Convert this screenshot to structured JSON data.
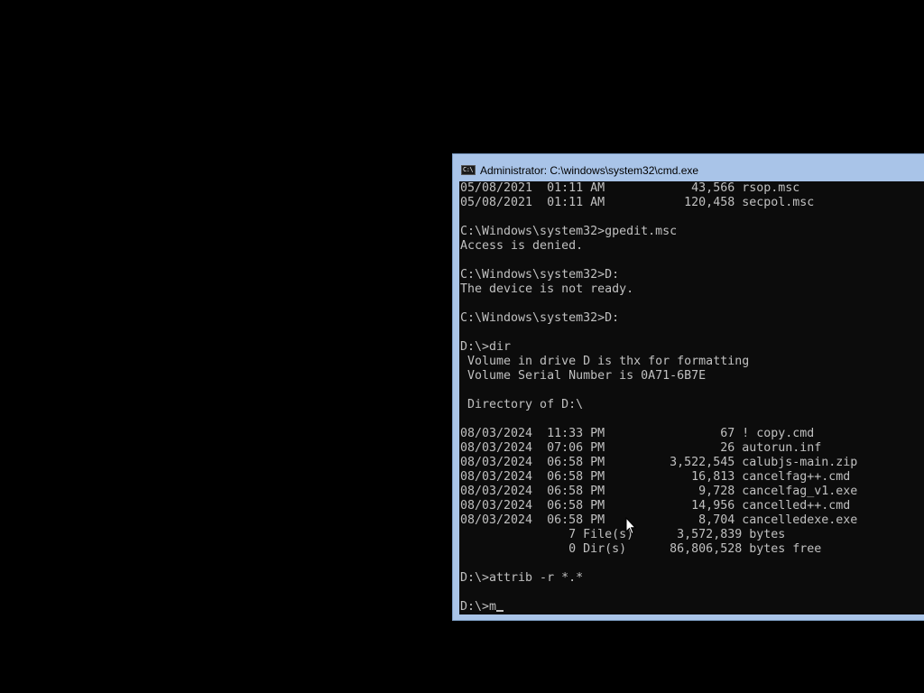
{
  "window": {
    "title": "Administrator: C:\\windows\\system32\\cmd.exe",
    "icon_label": "C:\\",
    "icon_name": "cmd-app-icon"
  },
  "console": {
    "lines": [
      "05/08/2021  01:11 AM            43,566 rsop.msc",
      "05/08/2021  01:11 AM           120,458 secpol.msc",
      "",
      "C:\\Windows\\system32>gpedit.msc",
      "Access is denied.",
      "",
      "C:\\Windows\\system32>D:",
      "The device is not ready.",
      "",
      "C:\\Windows\\system32>D:",
      "",
      "D:\\>dir",
      " Volume in drive D is thx for formatting",
      " Volume Serial Number is 0A71-6B7E",
      "",
      " Directory of D:\\",
      "",
      "08/03/2024  11:33 PM                67 ! copy.cmd",
      "08/03/2024  07:06 PM                26 autorun.inf",
      "08/03/2024  06:58 PM         3,522,545 calubjs-main.zip",
      "08/03/2024  06:58 PM            16,813 cancelfag++.cmd",
      "08/03/2024  06:58 PM             9,728 cancelfag_v1.exe",
      "08/03/2024  06:58 PM            14,956 cancelled++.cmd",
      "08/03/2024  06:58 PM             8,704 cancelledexe.exe",
      "               7 File(s)      3,572,839 bytes",
      "               0 Dir(s)      86,806,528 bytes free",
      "",
      "D:\\>attrib -r *.*",
      ""
    ],
    "prompt": "D:\\>",
    "current_input": "m"
  },
  "colors": {
    "desktop": "#000000",
    "title_bar": "#a9c4e8",
    "console_background": "#0c0c0c",
    "console_text": "#c0c0c0"
  },
  "icons": {
    "mouse_pointer": "arrow-cursor-icon",
    "text_cursor": "text-cursor-icon"
  }
}
